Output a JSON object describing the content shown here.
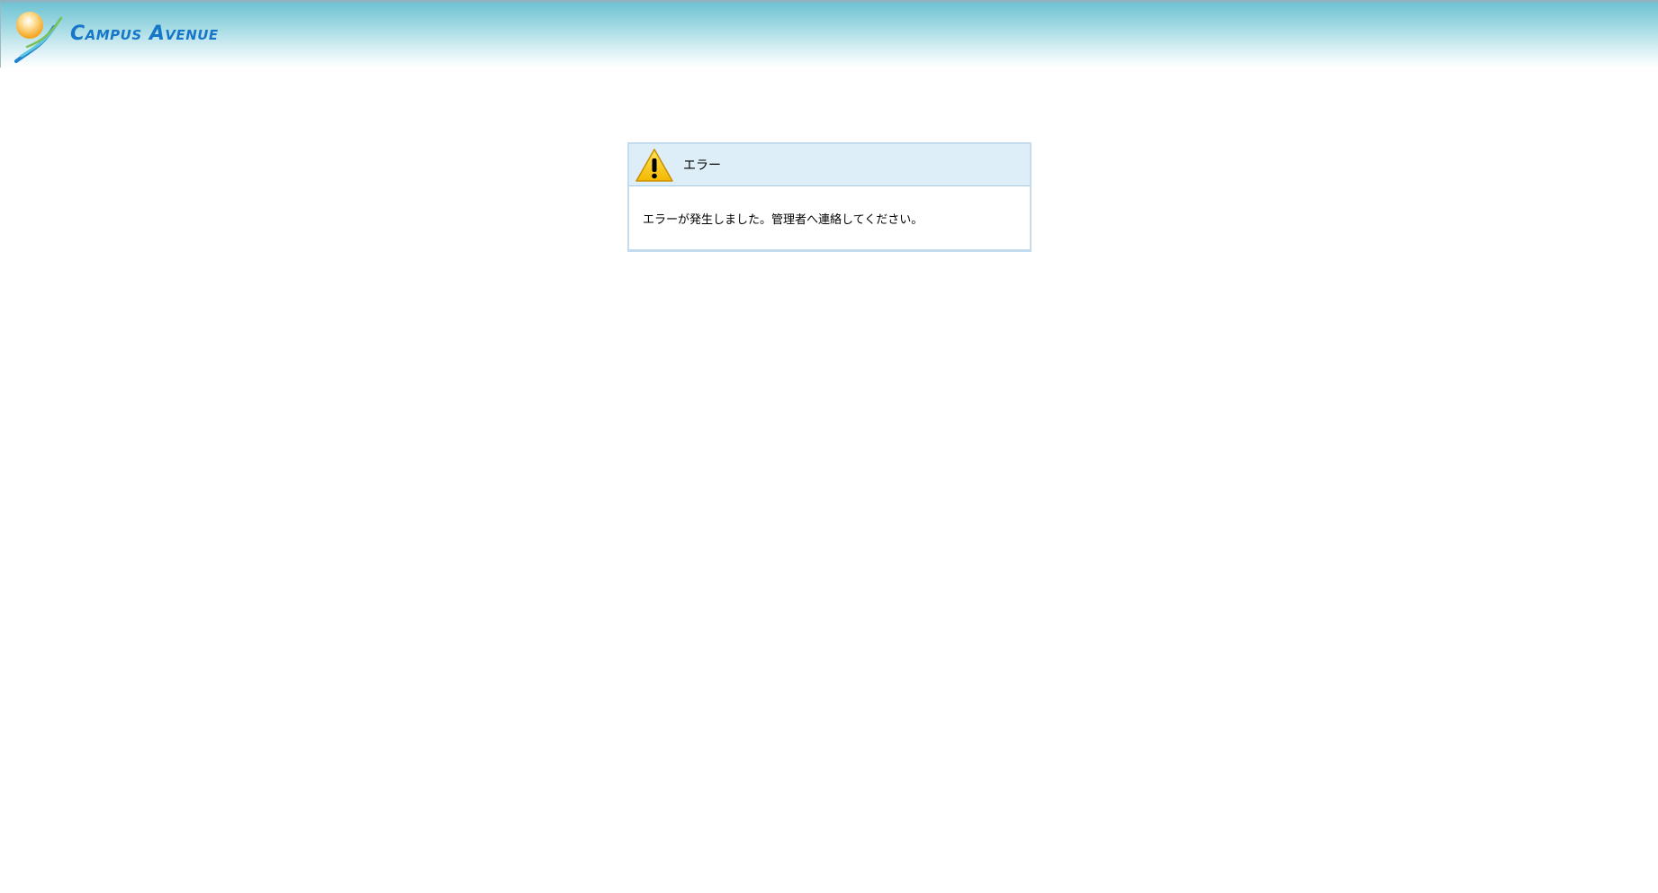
{
  "header": {
    "logo_text": "Campus Avenue",
    "colors": {
      "banner_top": "#6fc3d3",
      "logo_text": "#1677c9",
      "sun": "#f5a623"
    }
  },
  "dialog": {
    "icon": "warning-icon",
    "title": "エラー",
    "message": "エラーが発生しました。管理者へ連絡してください。",
    "colors": {
      "header_bg": "#ddeef8",
      "border": "#c4dcee",
      "warning": "#f6c400"
    }
  }
}
